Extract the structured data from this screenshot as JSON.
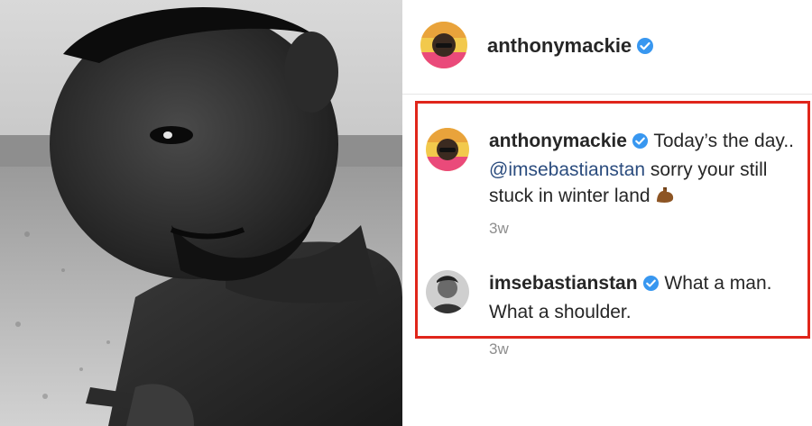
{
  "post": {
    "author": "anthonymackie"
  },
  "comments": [
    {
      "username": "anthonymackie",
      "text_line1": "Today’s the day..",
      "mention": "@imsebastianstan",
      "text_line2_rest": " sorry your still",
      "text_line3": "stuck in winter land",
      "emoji": "flexed-biceps-emoji",
      "time": "3w"
    },
    {
      "username": "imsebastianstan",
      "text_line1": "What a man.",
      "text_line2": "What a shoulder.",
      "time": "3w"
    }
  ],
  "colors": {
    "verified": "#3897f0",
    "highlight_border": "#e0261b",
    "mention": "#2b4c7e",
    "muted": "#8e8e8e"
  }
}
